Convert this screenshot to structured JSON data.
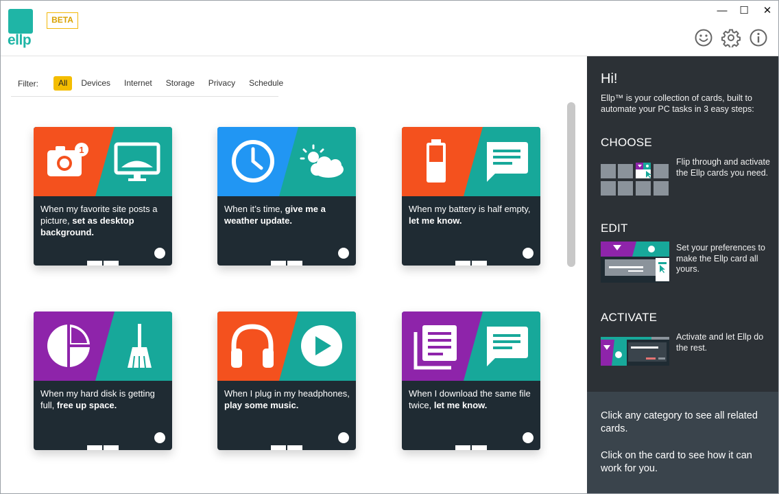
{
  "app": {
    "logo_text": "ellp",
    "beta_label": "BETA",
    "brand_color": "#1fb5a6",
    "accent_color": "#f4bd00"
  },
  "window_controls": {
    "minimize": "—",
    "maximize": "☐",
    "close": "✕"
  },
  "header_icons": [
    "smiley-icon",
    "gear-icon",
    "info-icon"
  ],
  "filter": {
    "label": "Filter:",
    "options": [
      "All",
      "Devices",
      "Internet",
      "Storage",
      "Privacy",
      "Schedule"
    ],
    "selected": "All"
  },
  "cards": [
    {
      "pre": "When my favorite site posts a picture, ",
      "bold": "set as desktop background.",
      "left_color": "#f4511e",
      "right_color": "#17a89a",
      "left_icon": "camera-icon",
      "right_icon": "desktop-icon",
      "badge": "1"
    },
    {
      "pre": "When it’s time, ",
      "bold": "give me a weather update.",
      "left_color": "#2196f3",
      "right_color": "#17a89a",
      "left_icon": "clock-icon",
      "right_icon": "weather-icon"
    },
    {
      "pre": "When my battery is half empty, ",
      "bold": "let me know.",
      "left_color": "#f4511e",
      "right_color": "#17a89a",
      "left_icon": "battery-icon",
      "right_icon": "message-icon"
    },
    {
      "pre": "When my hard disk is getting full, ",
      "bold": "free up space.",
      "left_color": "#8e24aa",
      "right_color": "#17a89a",
      "left_icon": "pie-chart-icon",
      "right_icon": "broom-icon"
    },
    {
      "pre": "When I plug in my headphones, ",
      "bold": "play some music.",
      "left_color": "#f4511e",
      "right_color": "#17a89a",
      "left_icon": "headphones-icon",
      "right_icon": "play-icon"
    },
    {
      "pre": "When I download the same file twice, ",
      "bold": "let me know.",
      "left_color": "#8e24aa",
      "right_color": "#17a89a",
      "left_icon": "documents-icon",
      "right_icon": "message-icon"
    }
  ],
  "panel": {
    "greeting": "Hi!",
    "intro": "Ellp™ is your collection of cards, built to automate your PC tasks in 3 easy steps:",
    "steps": [
      {
        "title": "CHOOSE",
        "desc": "Flip through and activate the Ellp cards you need."
      },
      {
        "title": "EDIT",
        "desc": "Set your preferences to make the Ellp card all yours."
      },
      {
        "title": "ACTIVATE",
        "desc": "Activate and let Ellp do the rest."
      }
    ],
    "tip1": "Click any category to see all related cards.",
    "tip2": "Click on the card to see how it can work for you."
  }
}
